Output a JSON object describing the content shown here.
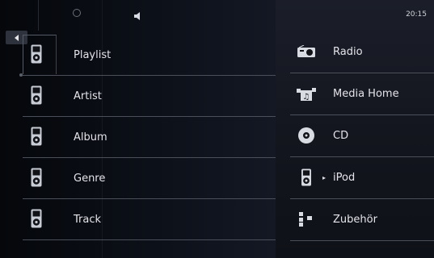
{
  "status": {
    "clock": "20:15",
    "icons": [
      "circle-icon",
      "speaker-icon"
    ]
  },
  "navigation": {
    "back_icon": "back-arrow-icon"
  },
  "browse_menu": {
    "items": [
      {
        "label": "Playlist",
        "icon": "ipod-icon"
      },
      {
        "label": "Artist",
        "icon": "ipod-icon"
      },
      {
        "label": "Album",
        "icon": "ipod-icon"
      },
      {
        "label": "Genre",
        "icon": "ipod-icon"
      },
      {
        "label": "Track",
        "icon": "ipod-icon"
      }
    ]
  },
  "sources": {
    "items": [
      {
        "label": "Radio",
        "icon": "radio-icon"
      },
      {
        "label": "Media Home",
        "icon": "media-home-icon"
      },
      {
        "label": "CD",
        "icon": "cd-icon"
      },
      {
        "label": "iPod",
        "icon": "ipod-icon",
        "active_marker": "▸"
      },
      {
        "label": "Zubehör",
        "icon": "accessory-icon"
      }
    ]
  },
  "colors": {
    "text": "#e4e4ea",
    "divider": "#4a4f59",
    "left_bg": "#0c1018",
    "right_bg": "#1b1e29"
  }
}
